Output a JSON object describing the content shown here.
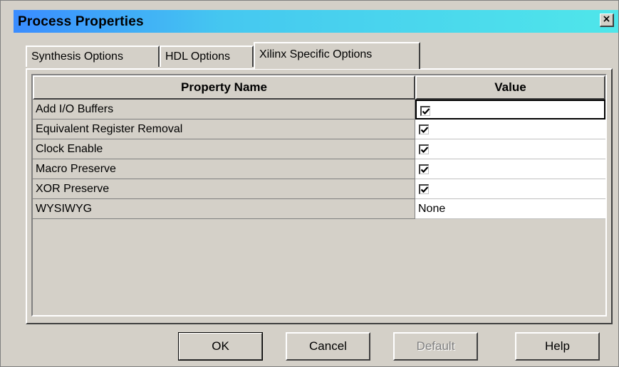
{
  "window": {
    "title": "Process Properties",
    "close_label": "×"
  },
  "tabs": [
    {
      "label": "Synthesis Options",
      "active": false
    },
    {
      "label": "HDL Options",
      "active": false
    },
    {
      "label": "Xilinx Specific Options",
      "active": true
    }
  ],
  "grid": {
    "headers": {
      "name": "Property Name",
      "value": "Value"
    },
    "rows": [
      {
        "name": "Add I/O Buffers",
        "value_type": "checkbox",
        "checked": true
      },
      {
        "name": "Equivalent Register Removal",
        "value_type": "checkbox",
        "checked": true
      },
      {
        "name": "Clock Enable",
        "value_type": "checkbox",
        "checked": true
      },
      {
        "name": "Macro Preserve",
        "value_type": "checkbox",
        "checked": true
      },
      {
        "name": "XOR Preserve",
        "value_type": "checkbox",
        "checked": true
      },
      {
        "name": "WYSIWYG",
        "value_type": "text",
        "value": "None"
      }
    ]
  },
  "buttons": {
    "ok": "OK",
    "cancel": "Cancel",
    "default": "Default",
    "help": "Help"
  },
  "colors": {
    "dialog_bg": "#d4d0c8",
    "title_gradient_start": "#3a8cff",
    "title_gradient_end": "#4fe6ea"
  }
}
